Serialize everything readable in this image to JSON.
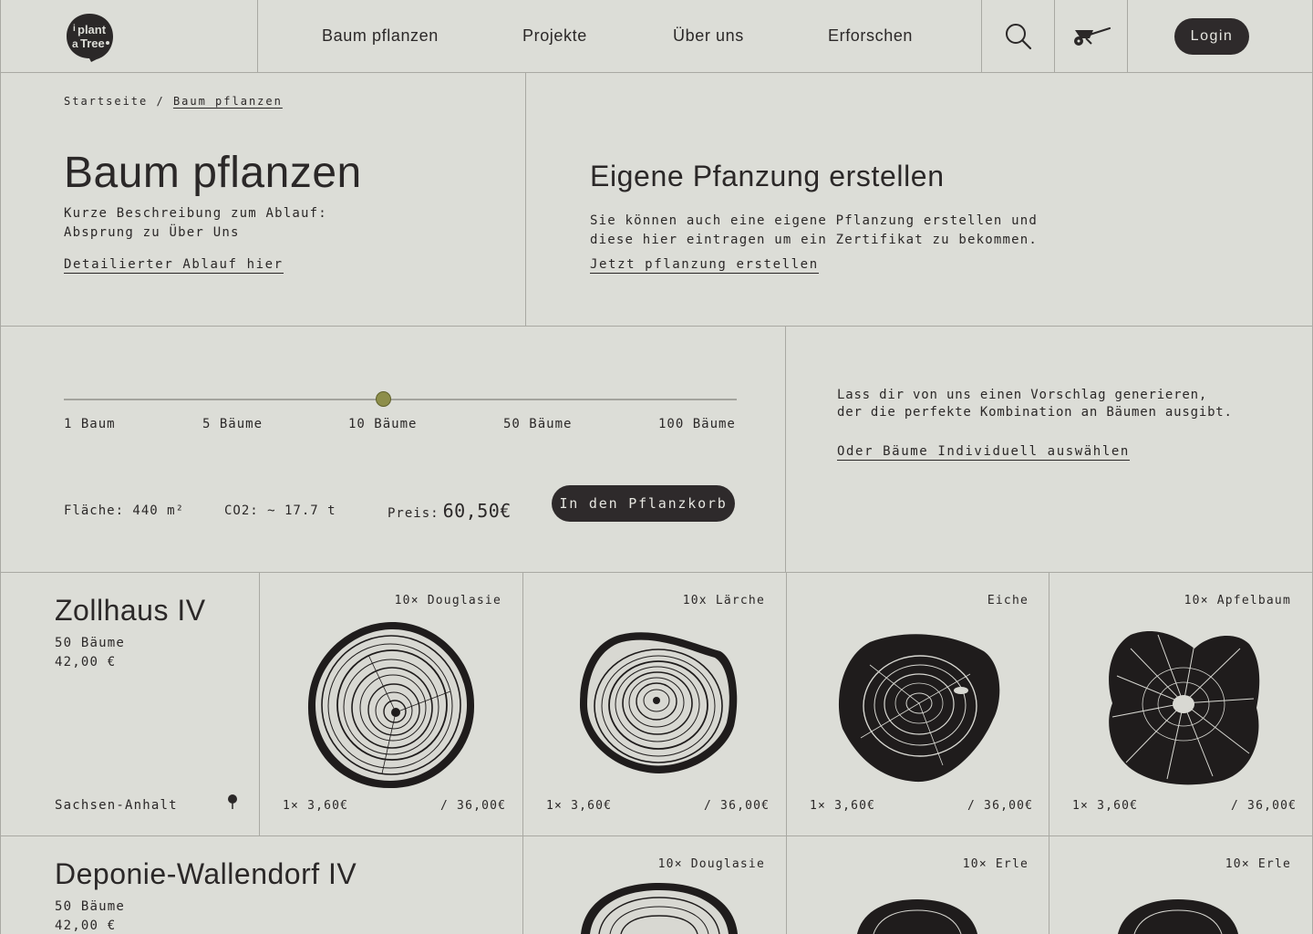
{
  "header": {
    "logo_text": "i plant a tree",
    "nav": [
      "Baum pflanzen",
      "Projekte",
      "Über uns",
      "Erforschen"
    ],
    "search_icon": "search-icon",
    "cart_icon": "wheelbarrow-icon",
    "login_label": "Login"
  },
  "breadcrumb": {
    "home": "Startseite",
    "separator": " / ",
    "current": "Baum pflanzen"
  },
  "hero": {
    "title": "Baum pflanzen",
    "desc_line1": "Kurze Beschreibung zum Ablauf:",
    "desc_line2": "Absprung zu Über Uns",
    "link": "Detailierter Ablauf hier"
  },
  "custom": {
    "title": "Eigene Pfanzung erstellen",
    "desc_line1": "Sie können auch eine eigene Pflanzung erstellen und",
    "desc_line2": "diese hier eintragen um ein Zertifikat zu bekommen.",
    "link": "Jetzt pflanzung erstellen"
  },
  "slider": {
    "ticks": [
      "1 Baum",
      "5 Bäume",
      "10 Bäume",
      "50 Bäume",
      "100 Bäume"
    ],
    "selected": "10 Bäume",
    "area_label": "Fläche: 440 m²",
    "co2_label": "CO2: ~ 17.7 t",
    "price_label": "Preis:",
    "price_value": "60,50€",
    "cart_button": "In den Pflanzkorb"
  },
  "suggestion": {
    "line1": "Lass dir von uns einen Vorschlag generieren,",
    "line2": "der die perfekte Kombination an Bäumen ausgibt.",
    "link": "Oder Bäume Individuell auswählen"
  },
  "projects": [
    {
      "name": "Zollhaus IV",
      "trees": "50 Bäume",
      "price": "42,00 €",
      "region": "Sachsen-Anhalt",
      "cards": [
        {
          "label": "10× Douglasie",
          "unit": "1× 3,60€",
          "total": "/ 36,00€"
        },
        {
          "label": "10x Lärche",
          "unit": "1× 3,60€",
          "total": "/ 36,00€"
        },
        {
          "label": "Eiche",
          "unit": "1× 3,60€",
          "total": "/ 36,00€"
        },
        {
          "label": "10× Apfelbaum",
          "unit": "1× 3,60€",
          "total": "/ 36,00€"
        }
      ]
    },
    {
      "name": "Deponie-Wallendorf IV",
      "trees": "50 Bäume",
      "price": "42,00 €",
      "cards": [
        {
          "label": "10× Douglasie"
        },
        {
          "label": "10× Erle"
        },
        {
          "label": "10× Erle"
        }
      ]
    }
  ],
  "colors": {
    "background": "#dcddd7",
    "text": "#2b2828",
    "button": "#2e2a2b",
    "slider_thumb": "#8d8e4a",
    "lines": "#a9a9a3"
  }
}
